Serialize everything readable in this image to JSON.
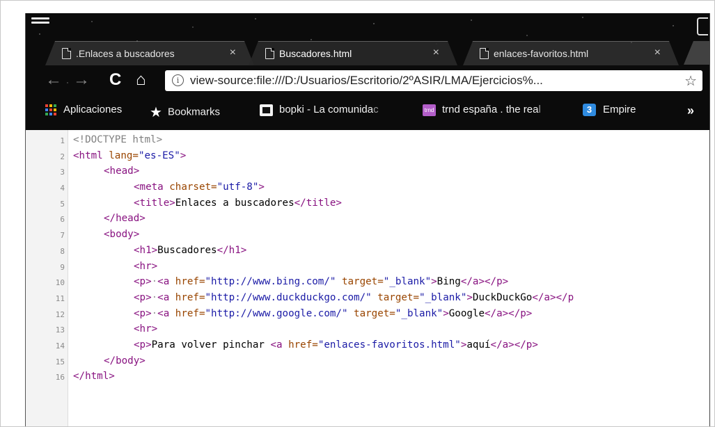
{
  "tabs": [
    {
      "label": ".Enlaces a buscadores",
      "close": "×",
      "active": false
    },
    {
      "label": "Buscadores.html",
      "close": "×",
      "active": true
    },
    {
      "label": "enlaces-favoritos.html",
      "close": "×",
      "active": false
    }
  ],
  "toolbar": {
    "back_icon": "←",
    "forward_icon": "→",
    "reload_icon": "C",
    "home_icon": "⌂",
    "info_icon": "i",
    "url": "view-source:file:///D:/Usuarios/Escritorio/2ºASIR/LMA/Ejercicios%...",
    "star_icon": "☆"
  },
  "bookmarks": {
    "apps": "Aplicaciones",
    "bookmarks": "Bookmarks",
    "bopki": "bopki - La comunida",
    "bopki_fade": "c",
    "trnd": "trnd españa . the rea",
    "trnd_fade": "l",
    "trnd_icon_text": "trnd",
    "empire": "Empire",
    "empire_icon_text": "3",
    "more": "»"
  },
  "source": {
    "lines": [
      {
        "n": "1"
      },
      {
        "n": "2"
      },
      {
        "n": "3"
      },
      {
        "n": "4"
      },
      {
        "n": "5"
      },
      {
        "n": "6"
      },
      {
        "n": "7"
      },
      {
        "n": "8"
      },
      {
        "n": "9"
      },
      {
        "n": "10"
      },
      {
        "n": "11"
      },
      {
        "n": "12"
      },
      {
        "n": "13"
      },
      {
        "n": "14"
      },
      {
        "n": "15"
      },
      {
        "n": "16"
      }
    ],
    "doctype": "<!DOCTYPE html>",
    "html_open": "<html",
    "lang_attr": " lang=",
    "lang_val": "\"es-ES\"",
    "gt": ">",
    "head_open": "<head>",
    "meta_open": "<meta",
    "charset_attr": " charset=",
    "charset_val": "\"utf-8\"",
    "title_open": "<title>",
    "title_text": "Enlaces a buscadores",
    "title_close": "</title>",
    "head_close": "</head>",
    "body_open": "<body>",
    "h1_open": "<h1>",
    "h1_text": "Buscadores",
    "h1_close": "</h1>",
    "hr": "<hr>",
    "p_open": "<p>",
    "dot": "·",
    "a_open": "<a",
    "href_attr": " href=",
    "target_attr": " target=",
    "blank_val": "\"_blank\"",
    "bing_url": "\"http://www.bing.com/\"",
    "bing_text": "Bing",
    "ddg_url": "\"http://www.duckduckgo.com/\"",
    "ddg_text": "DuckDuckGo",
    "google_url": "\"http://www.google.com/\"",
    "google_text": "Google",
    "a_close": "</a>",
    "p_close": "</p>",
    "p_close_cut": "</p",
    "volver_text": "Para volver pinchar ",
    "fav_url": "\"enlaces-favoritos.html\"",
    "aqui_text": "aquí",
    "body_close": "</body>",
    "html_close": "</html>"
  }
}
